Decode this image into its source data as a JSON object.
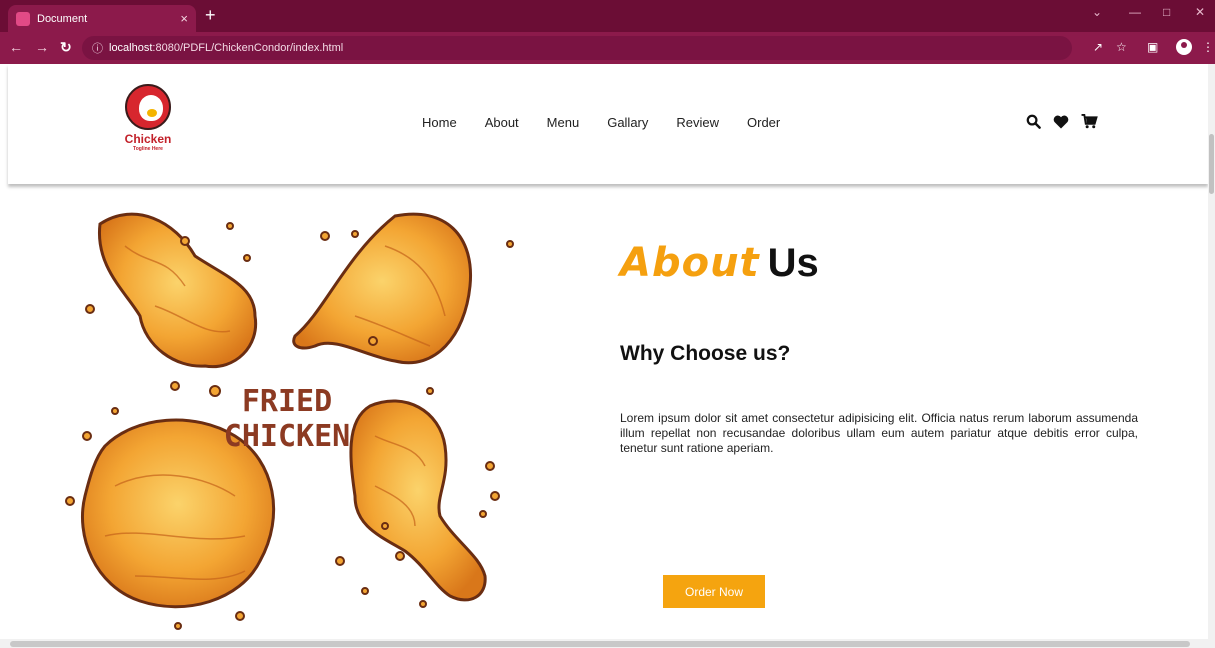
{
  "browser": {
    "tab_title": "Document",
    "tab_close": "×",
    "new_tab": "+",
    "url_host": "localhost",
    "url_path": ":8080/PDFL/ChickenCondor/index.html",
    "icons": [
      "back-icon",
      "forward-icon",
      "reload-icon",
      "info-icon",
      "share-icon",
      "star-icon",
      "sidepanel-icon",
      "profile-icon",
      "menu-icon"
    ]
  },
  "logo": {
    "name": "Chicken",
    "tagline": "Togline Here"
  },
  "nav": {
    "items": [
      "Home",
      "About",
      "Menu",
      "Gallary",
      "Review",
      "Order"
    ]
  },
  "header_icons": [
    "search-icon",
    "heart-icon",
    "cart-icon"
  ],
  "illustration": {
    "text_line1": "FRIED",
    "text_line2": "CHICKEN"
  },
  "about": {
    "title_highlight": "About",
    "title_rest": "Us",
    "subtitle": "Why Choose us?",
    "paragraph": "Lorem ipsum dolor sit amet consectetur adipisicing elit. Officia natus rerum laborum assumenda illum repellat non recusandae doloribus ullam eum autem pariatur atque debitis error culpa, tenetur sunt ratione aperiam.",
    "button_label": "Order Now"
  },
  "colors": {
    "accent": "#f5a00f",
    "browser_frame": "#8c1a4b",
    "browser_tabbar": "#6b0d35",
    "logo_red": "#d7262e"
  }
}
